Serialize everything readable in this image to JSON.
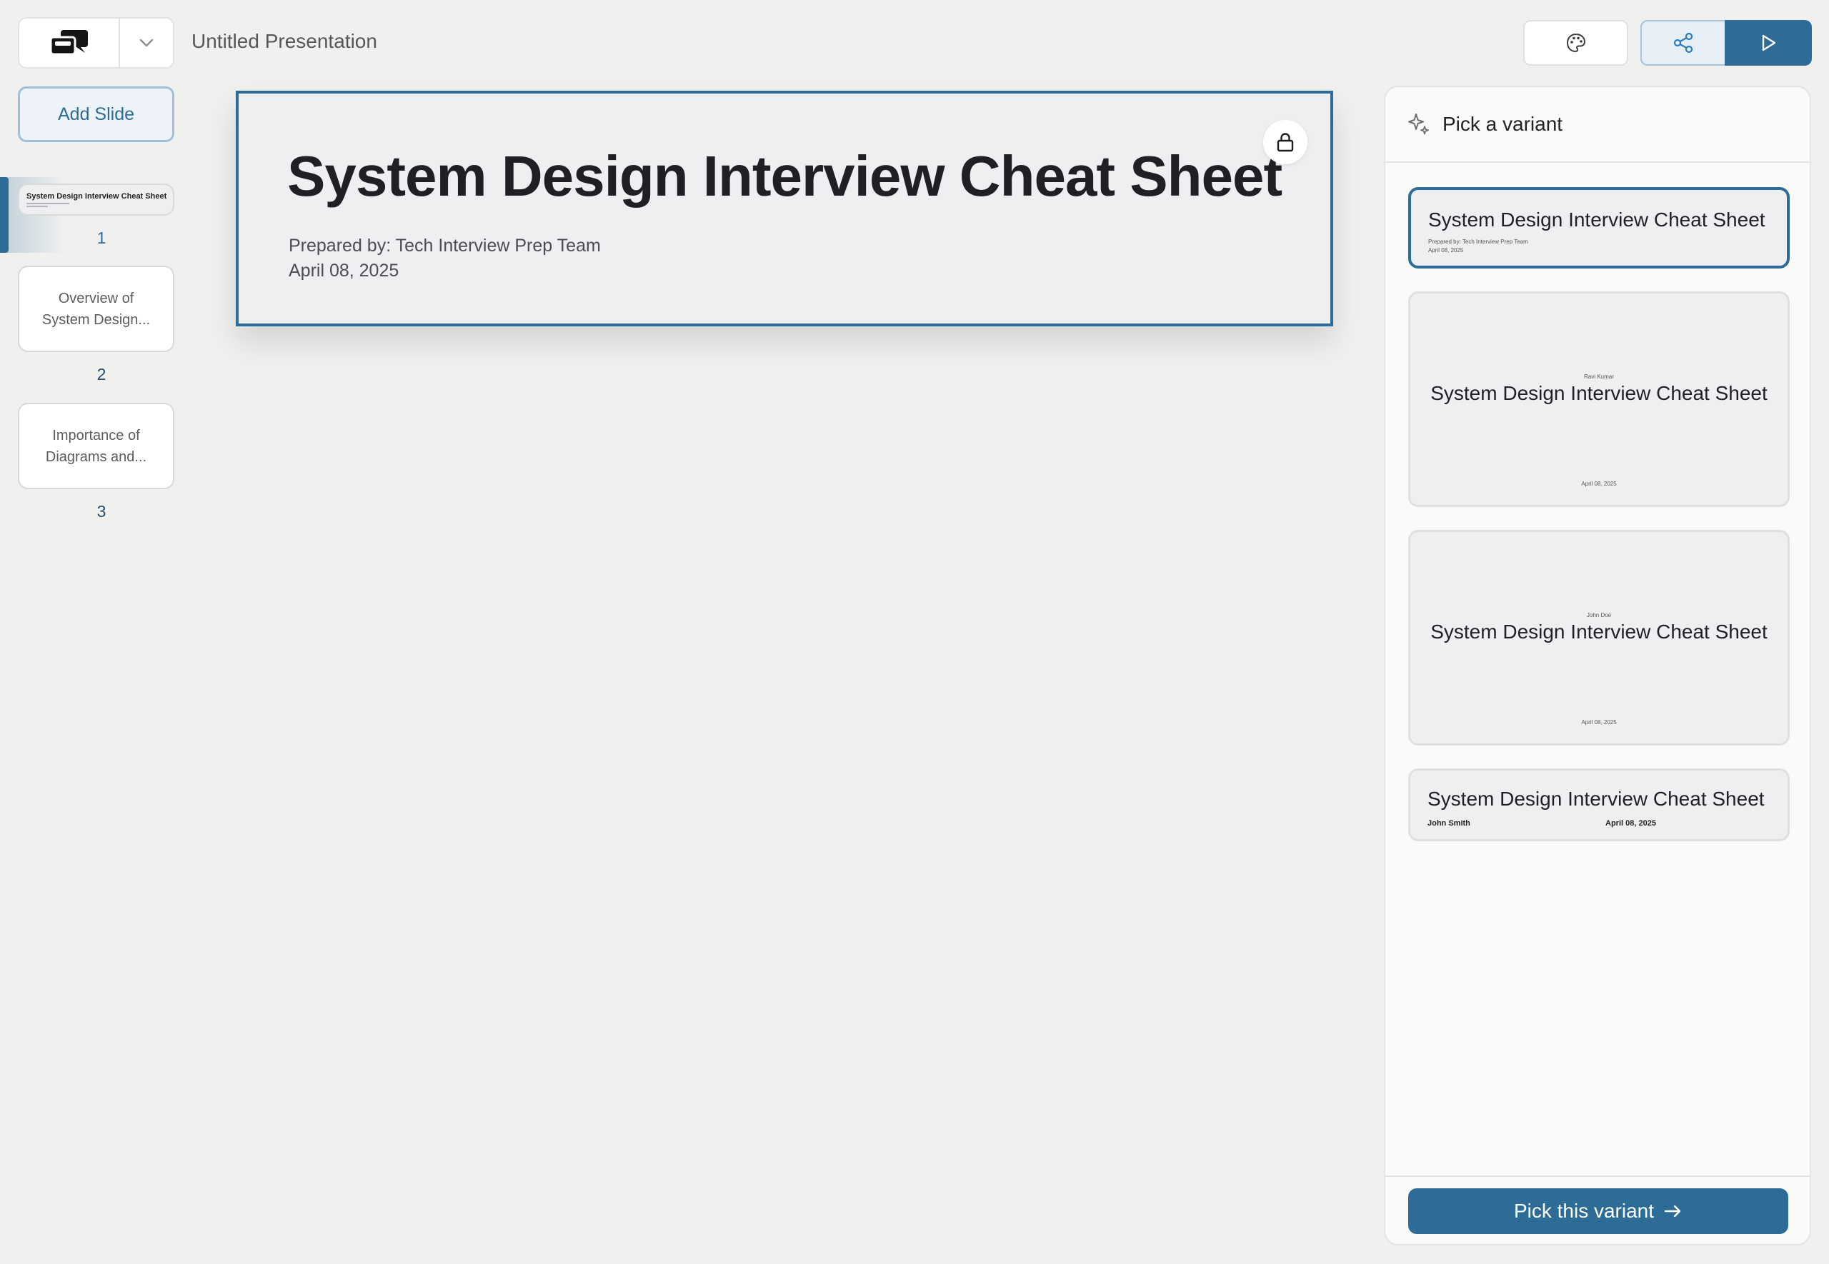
{
  "header": {
    "title": "Untitled Presentation",
    "logo_icon": "chat-bubbles-logo",
    "actions": [
      "palette-icon",
      "share-icon",
      "play-icon"
    ]
  },
  "sidebar": {
    "add_slide_label": "Add Slide",
    "slides": [
      {
        "number": "1",
        "thumb_title": "System Design Interview Cheat Sheet"
      },
      {
        "number": "2",
        "thumb_text": "Overview of System Design..."
      },
      {
        "number": "3",
        "thumb_text": "Importance of Diagrams and..."
      }
    ]
  },
  "slide": {
    "title": "System Design Interview Cheat Sheet",
    "prepared_by": "Prepared by: Tech Interview Prep Team",
    "date": "April 08, 2025"
  },
  "panel": {
    "title": "Pick a variant",
    "variants": [
      {
        "title": "System Design Interview Cheat Sheet",
        "line1": "Prepared by: Tech Interview Prep Team",
        "line2": "April 08, 2025"
      },
      {
        "title": "System Design Interview Cheat Sheet",
        "author": "Ravi Kumar",
        "date": "April 08, 2025"
      },
      {
        "title": "System Design Interview Cheat Sheet",
        "author": "John Doe",
        "date": "April 08, 2025"
      },
      {
        "title": "System Design Interview Cheat Sheet",
        "author": "John Smith",
        "date": "April 08, 2025"
      }
    ],
    "pick_label": "Pick this variant"
  },
  "colors": {
    "accent": "#2e6c98",
    "background": "#f0f0ef"
  }
}
